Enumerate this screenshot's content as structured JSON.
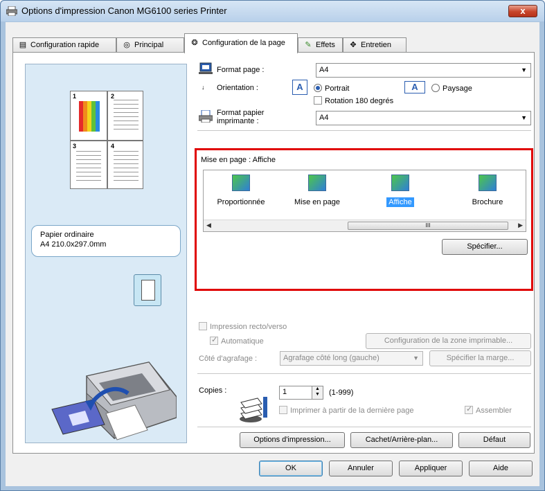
{
  "window": {
    "title": "Options d'impression Canon MG6100 series Printer",
    "close_label": "x"
  },
  "tabs": [
    {
      "label": "Configuration rapide",
      "icon": "quick-setup-icon"
    },
    {
      "label": "Principal",
      "icon": "main-icon"
    },
    {
      "label": "Configuration de la page",
      "icon": "page-setup-icon",
      "active": true
    },
    {
      "label": "Effets",
      "icon": "effects-icon"
    },
    {
      "label": "Entretien",
      "icon": "maintenance-icon"
    }
  ],
  "preview": {
    "page_numbers": [
      "1",
      "2",
      "3",
      "4"
    ],
    "paper_type": "Papier ordinaire",
    "paper_size": "A4 210.0x297.0mm"
  },
  "page_setup": {
    "page_size_label": "Format page :",
    "page_size_value": "A4",
    "orientation_label": "Orientation :",
    "portrait_label": "Portrait",
    "landscape_label": "Paysage",
    "orientation_selected": "Portrait",
    "rotate_label": "Rotation 180 degrés",
    "printer_paper_label_1": "Format papier",
    "printer_paper_label_2": "imprimante :",
    "printer_paper_value": "A4"
  },
  "layout": {
    "heading": "Mise en page : Affiche",
    "items": [
      {
        "label": "Proportionnée",
        "icon": "scaled-layout-icon"
      },
      {
        "label": "Mise en page",
        "icon": "page-layout-icon"
      },
      {
        "label": "Affiche",
        "icon": "poster-layout-icon",
        "selected": true
      },
      {
        "label": "Brochure",
        "icon": "booklet-layout-icon"
      }
    ],
    "scroll_grip": "III",
    "specify_button": "Spécifier..."
  },
  "duplex": {
    "label": "Impression recto/verso",
    "auto_label": "Automatique",
    "print_area_button": "Configuration de la zone imprimable...",
    "stapling_label": "Côté d'agrafage :",
    "stapling_value": "Agrafage côté long (gauche)",
    "margin_button": "Spécifier la marge..."
  },
  "copies": {
    "label": "Copies :",
    "value": "1",
    "range": "(1-999)",
    "reverse_label": "Imprimer à partir de la dernière page",
    "collate_label": "Assembler"
  },
  "bottom_buttons": {
    "print_options": "Options d'impression...",
    "stamp_background": "Cachet/Arrière-plan...",
    "defaults": "Défaut"
  },
  "dialog_buttons": {
    "ok": "OK",
    "cancel": "Annuler",
    "apply": "Appliquer",
    "help": "Aide"
  },
  "colors": {
    "highlight_border": "#e00000",
    "selection": "#3399ff"
  }
}
